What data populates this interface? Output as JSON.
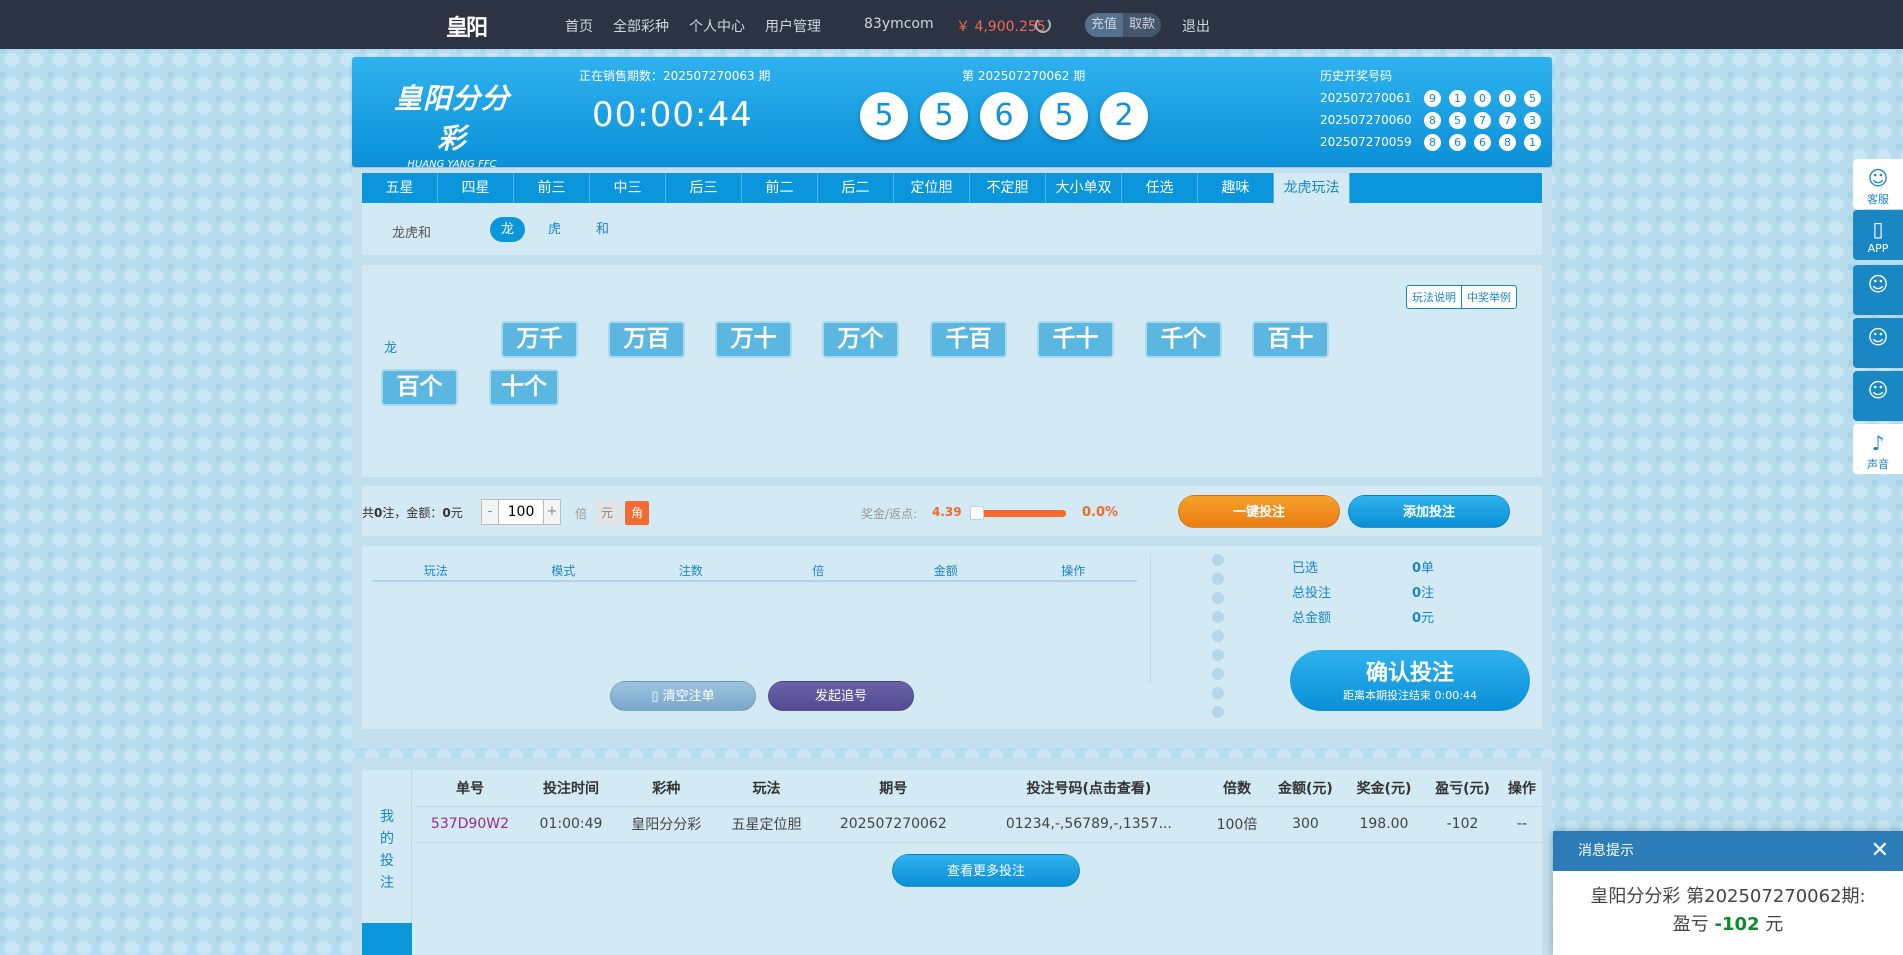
{
  "nav": {
    "logo": "皇阳",
    "links": [
      "首页",
      "全部彩种",
      "个人中心",
      "用户管理"
    ],
    "username": "83ymcom",
    "balance": "￥ 4,900.255",
    "recharge": "充值",
    "withdraw": "取款",
    "logout": "退出"
  },
  "header": {
    "brand_cn": "皇阳分分彩",
    "brand_en": "HUANG YANG FFC",
    "sale_label": "正在销售期数：202507270063 期",
    "countdown": "00:00:44",
    "draw_label": "第 202507270062 期",
    "draw_balls": [
      "5",
      "5",
      "6",
      "5",
      "2"
    ],
    "history_title": "历史开奖号码",
    "history": [
      {
        "issue": "202507270061",
        "nums": [
          "9",
          "1",
          "0",
          "0",
          "5"
        ]
      },
      {
        "issue": "202507270060",
        "nums": [
          "8",
          "5",
          "7",
          "7",
          "3"
        ]
      },
      {
        "issue": "202507270059",
        "nums": [
          "8",
          "6",
          "6",
          "8",
          "1"
        ]
      }
    ]
  },
  "tabs": [
    "五星",
    "四星",
    "前三",
    "中三",
    "后三",
    "前二",
    "后二",
    "定位胆",
    "不定胆",
    "大小单双",
    "任选",
    "趣味",
    "龙虎玩法"
  ],
  "active_tab": "龙虎玩法",
  "subplay": {
    "label": "龙虎和",
    "options": [
      "龙",
      "虎",
      "和"
    ],
    "selected": "龙"
  },
  "pick": {
    "help_rules": "玩法说明",
    "help_example": "中奖举例",
    "row_label": "龙",
    "buttons": [
      "万千",
      "万百",
      "万十",
      "万个",
      "千百",
      "千十",
      "千个",
      "百十",
      "百个",
      "十个"
    ]
  },
  "bet": {
    "summary_count_label": "共",
    "count": "0",
    "summary_mid": "注，金额：",
    "amount": "0",
    "summary_unit": "元",
    "multiplier": "100",
    "bei": "倍",
    "unit_yuan": "元",
    "unit_jiao": "角",
    "rebate_label": "奖金/返点:",
    "rebate_value": "4.39",
    "rebate_percent": "0.0%",
    "rebate_level": 0.0,
    "quick_bet": "一键投注",
    "add_bet": "添加投注"
  },
  "cart": {
    "columns": [
      "玩法",
      "模式",
      "注数",
      "倍",
      "金额",
      "操作"
    ],
    "clear_btn": "清空注单",
    "chase_btn": "发起追号",
    "selected_label": "已选",
    "selected_value": "0",
    "selected_unit": "单",
    "total_bets_label": "总投注",
    "total_bets_value": "0",
    "total_bets_unit": "注",
    "total_amount_label": "总金额",
    "total_amount_value": "0",
    "total_amount_unit": "元",
    "confirm": "确认投注",
    "confirm_sub": "距离本期投注结束 0:00:44"
  },
  "orders": {
    "side_label": [
      "我",
      "的",
      "投",
      "注"
    ],
    "columns": [
      "单号",
      "投注时间",
      "彩种",
      "玩法",
      "期号",
      "投注号码(点击查看)",
      "倍数",
      "金额(元)",
      "奖金(元)",
      "盈亏(元)",
      "操作"
    ],
    "rows": [
      [
        "537D90W2",
        "01:00:49",
        "皇阳分分彩",
        "五星定位胆",
        "202507270062",
        "01234,-,56789,-,1357...",
        "100倍",
        "300",
        "198.00",
        "-102",
        "--"
      ]
    ],
    "more": "查看更多投注"
  },
  "float": [
    {
      "label": "客服",
      "icon": "headset-icon"
    },
    {
      "label": "APP",
      "icon": "phone-icon"
    },
    {
      "label": "",
      "icon": "headset-icon"
    },
    {
      "label": "",
      "icon": "headset-icon"
    },
    {
      "label": "",
      "icon": "headset-icon"
    },
    {
      "label": "声音",
      "icon": "speaker-icon"
    }
  ],
  "toast": {
    "title": "消息提示",
    "line1": "皇阳分分彩 第202507270062期:",
    "line2_prefix": "盈亏",
    "profit": "-102",
    "line2_suffix": "元"
  },
  "colors": {
    "brand_blue": "#0b96db",
    "orange": "#f08a1c",
    "loss_green": "#0a8a2e",
    "nav_bg": "#2c3444"
  }
}
